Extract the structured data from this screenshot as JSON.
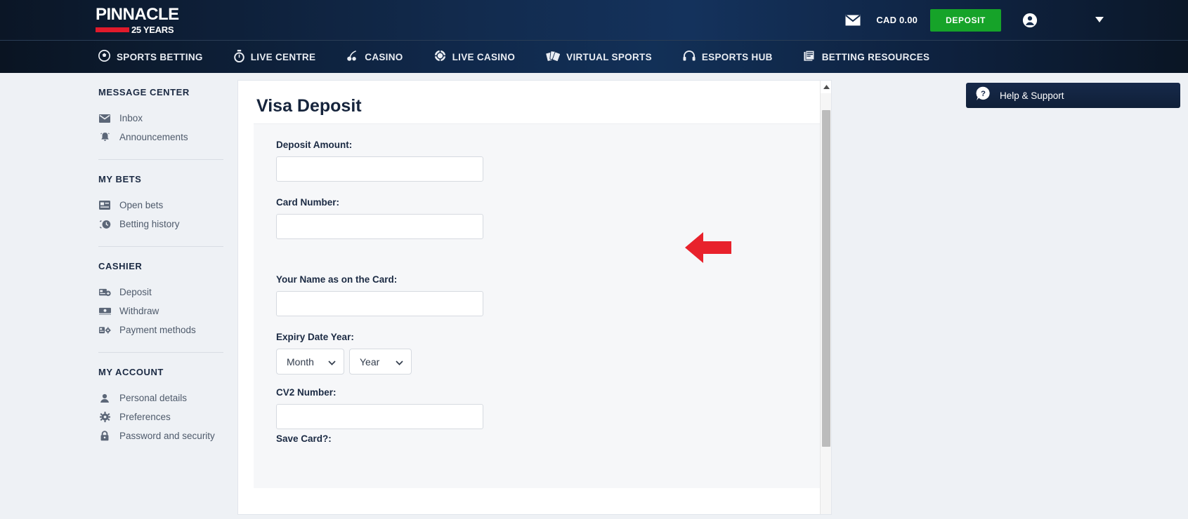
{
  "brand": {
    "logo_word": "PINNACLE",
    "logo_years": "25 YEARS",
    "accent_red": "#e01a2b",
    "accent_green": "#16a329",
    "navy": "#12294a"
  },
  "header": {
    "mail_icon": "envelope-icon",
    "balance": "CAD 0.00",
    "deposit_label": "DEPOSIT",
    "account_icon": "account-circle-icon",
    "caret_icon": "caret-down-icon"
  },
  "nav": {
    "items": [
      {
        "label": "SPORTS BETTING",
        "icon": "soccer-ball-icon"
      },
      {
        "label": "LIVE CENTRE",
        "icon": "stopwatch-icon"
      },
      {
        "label": "CASINO",
        "icon": "cherries-icon"
      },
      {
        "label": "LIVE CASINO",
        "icon": "casino-chip-icon"
      },
      {
        "label": "VIRTUAL SPORTS",
        "icon": "playing-cards-icon"
      },
      {
        "label": "ESPORTS HUB",
        "icon": "headset-icon"
      },
      {
        "label": "BETTING RESOURCES",
        "icon": "newspaper-icon"
      }
    ]
  },
  "sidebar": {
    "groups": [
      {
        "title": "MESSAGE CENTER",
        "items": [
          {
            "label": "Inbox",
            "icon": "envelope-icon"
          },
          {
            "label": "Announcements",
            "icon": "bell-icon"
          }
        ]
      },
      {
        "title": "MY BETS",
        "items": [
          {
            "label": "Open bets",
            "icon": "bet-slip-icon"
          },
          {
            "label": "Betting history",
            "icon": "history-clock-icon"
          }
        ]
      },
      {
        "title": "CASHIER",
        "items": [
          {
            "label": "Deposit",
            "icon": "card-plus-icon"
          },
          {
            "label": "Withdraw",
            "icon": "banknote-icon"
          },
          {
            "label": "Payment methods",
            "icon": "card-gear-icon"
          }
        ]
      },
      {
        "title": "MY ACCOUNT",
        "items": [
          {
            "label": "Personal details",
            "icon": "person-icon"
          },
          {
            "label": "Preferences",
            "icon": "gear-icon"
          },
          {
            "label": "Password and security",
            "icon": "lock-icon"
          }
        ]
      }
    ]
  },
  "form": {
    "title": "Visa Deposit",
    "deposit_amount_label": "Deposit Amount:",
    "deposit_amount_value": "",
    "card_number_label": "Card Number:",
    "card_number_value": "",
    "name_on_card_label": "Your Name as on the Card:",
    "name_on_card_value": "",
    "expiry_label": "Expiry Date Year:",
    "expiry_month_value": "Month",
    "expiry_year_value": "Year",
    "cv2_label": "CV2 Number:",
    "cv2_value": "",
    "save_card_label": "Save Card?:"
  },
  "rail": {
    "help_label": "Help & Support",
    "help_icon": "question-bubble-icon"
  },
  "annotation": {
    "arrow_icon": "red-left-arrow-pointer",
    "arrow_color": "#e8222c"
  },
  "scrollbar": {
    "up_icon": "scroll-up-arrow-icon"
  }
}
